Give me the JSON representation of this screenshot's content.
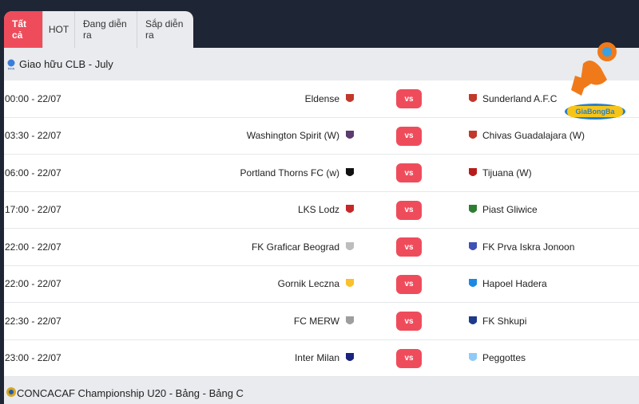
{
  "tabs": [
    {
      "label": "Tất cả",
      "active": true
    },
    {
      "label": "HOT"
    },
    {
      "label": "Đang diễn ra"
    },
    {
      "label": "Sắp diễn ra"
    }
  ],
  "league1": {
    "name": "Giao hữu CLB - July",
    "icon": "fifa-icon"
  },
  "vs_label": "vs",
  "matches": [
    {
      "time": "00:00  -  22/07",
      "home": "Eldense",
      "away": "Sunderland A.F.C"
    },
    {
      "time": "03:30  -  22/07",
      "home": "Washington Spirit (W)",
      "away": "Chivas Guadalajara (W)"
    },
    {
      "time": "06:00  -  22/07",
      "home": "Portland Thorns FC (w)",
      "away": "Tijuana (W)"
    },
    {
      "time": "17:00  -  22/07",
      "home": "LKS Lodz",
      "away": "Piast Gliwice"
    },
    {
      "time": "22:00  -  22/07",
      "home": "FK Graficar Beograd",
      "away": "FK Prva Iskra Jonoon"
    },
    {
      "time": "22:00  -  22/07",
      "home": "Gornik Leczna",
      "away": "Hapoel Hadera"
    },
    {
      "time": "22:30  -  22/07",
      "home": "FC MERW",
      "away": "FK Shkupi"
    },
    {
      "time": "23:00  -  22/07",
      "home": "Inter Milan",
      "away": "Peggottes"
    }
  ],
  "league2": {
    "name": "CONCACAF Championship U20 - Bảng - Bảng C",
    "icon": "concacaf-icon"
  },
  "colors": {
    "accent": "#ef4c5b",
    "background": "#1e2535",
    "header_bg": "#e9ebee"
  }
}
